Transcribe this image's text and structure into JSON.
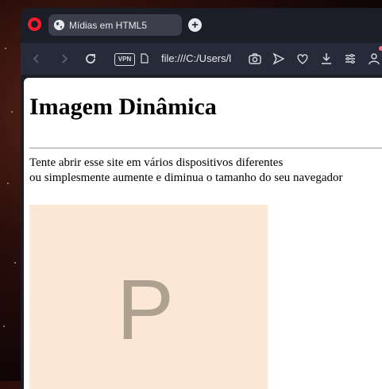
{
  "browser": {
    "tab_title": "Mídias em HTML5",
    "new_tab_symbol": "+",
    "vpn_label": "VPN",
    "url": "file:///C:/Users/l"
  },
  "page": {
    "heading": "Imagem Dinâmica",
    "line1": "Tente abrir esse site em vários dispositivos diferentes",
    "line2": "ou simplesmente aumente e diminua o tamanho do seu navegador",
    "placeholder_letter": "P"
  }
}
